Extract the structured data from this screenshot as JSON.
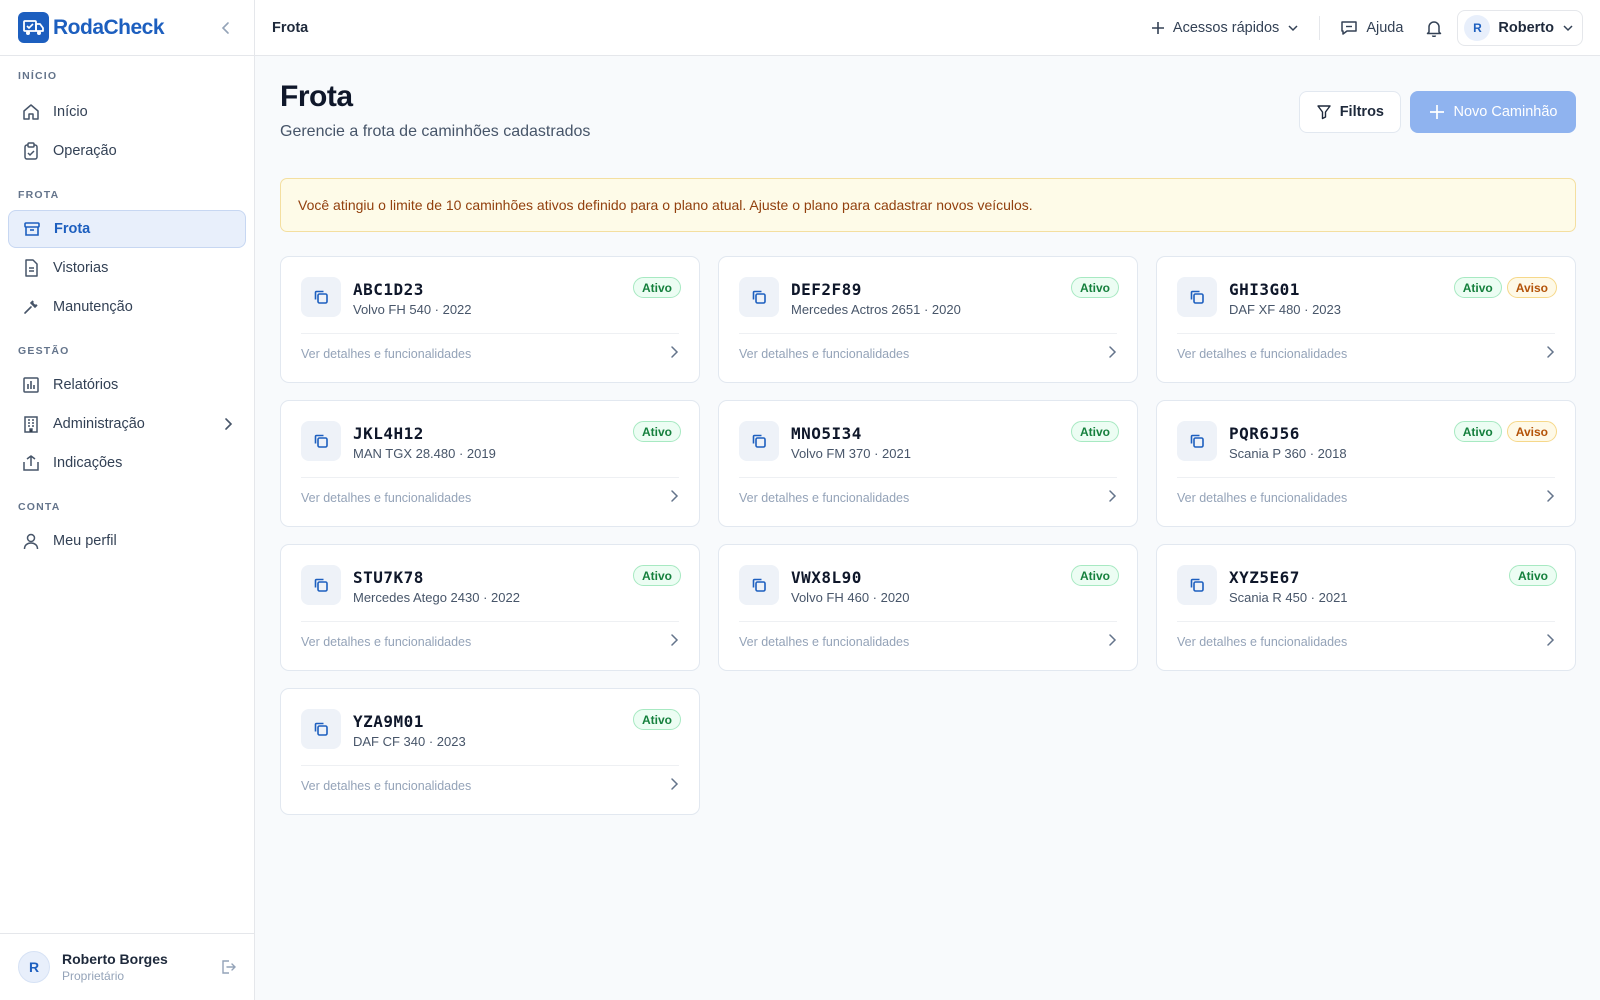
{
  "brand": {
    "name": "RodaCheck",
    "accent": "#1d5fbf"
  },
  "sidebar": {
    "sections": [
      {
        "label": "INÍCIO",
        "items": [
          {
            "label": "Início",
            "icon": "home-icon"
          },
          {
            "label": "Operação",
            "icon": "clipboard-icon"
          }
        ]
      },
      {
        "label": "FROTA",
        "items": [
          {
            "label": "Frota",
            "icon": "archive-icon",
            "active": true
          },
          {
            "label": "Vistorias",
            "icon": "document-icon"
          },
          {
            "label": "Manutenção",
            "icon": "wrench-icon"
          }
        ]
      },
      {
        "label": "GESTÃO",
        "items": [
          {
            "label": "Relatórios",
            "icon": "chart-icon"
          },
          {
            "label": "Administração",
            "icon": "building-icon",
            "has_submenu": true
          },
          {
            "label": "Indicações",
            "icon": "share-icon"
          }
        ]
      },
      {
        "label": "CONTA",
        "items": [
          {
            "label": "Meu perfil",
            "icon": "user-icon"
          }
        ]
      }
    ],
    "footer": {
      "avatar_initial": "R",
      "name": "Roberto Borges",
      "role": "Proprietário"
    }
  },
  "topbar": {
    "title": "Frota",
    "quick_access": "Acessos rápidos",
    "help": "Ajuda",
    "user_initial": "R",
    "user_name": "Roberto"
  },
  "page": {
    "title": "Frota",
    "subtitle": "Gerencie a frota de caminhões cadastrados",
    "filters_button": "Filtros",
    "new_button": "Novo Caminhão",
    "alert": "Você atingiu o limite de 10 caminhões ativos definido para o plano atual. Ajuste o plano para cadastrar novos veículos."
  },
  "trucks": [
    {
      "plate": "ABC1D23",
      "model": "Volvo FH 540 · 2022",
      "badges": [
        "Ativo"
      ],
      "link": "Ver detalhes e funcionalidades"
    },
    {
      "plate": "DEF2F89",
      "model": "Mercedes Actros 2651 · 2020",
      "badges": [
        "Ativo"
      ],
      "link": "Ver detalhes e funcionalidades"
    },
    {
      "plate": "GHI3G01",
      "model": "DAF XF 480 · 2023",
      "badges": [
        "Ativo",
        "Aviso"
      ],
      "link": "Ver detalhes e funcionalidades"
    },
    {
      "plate": "JKL4H12",
      "model": "MAN TGX 28.480 · 2019",
      "badges": [
        "Ativo"
      ],
      "link": "Ver detalhes e funcionalidades"
    },
    {
      "plate": "MNO5I34",
      "model": "Volvo FM 370 · 2021",
      "badges": [
        "Ativo"
      ],
      "link": "Ver detalhes e funcionalidades"
    },
    {
      "plate": "PQR6J56",
      "model": "Scania P 360 · 2018",
      "badges": [
        "Ativo",
        "Aviso"
      ],
      "link": "Ver detalhes e funcionalidades"
    },
    {
      "plate": "STU7K78",
      "model": "Mercedes Atego 2430 · 2022",
      "badges": [
        "Ativo"
      ],
      "link": "Ver detalhes e funcionalidades"
    },
    {
      "plate": "VWX8L90",
      "model": "Volvo FH 460 · 2020",
      "badges": [
        "Ativo"
      ],
      "link": "Ver detalhes e funcionalidades"
    },
    {
      "plate": "XYZ5E67",
      "model": "Scania R 450 · 2021",
      "badges": [
        "Ativo"
      ],
      "link": "Ver detalhes e funcionalidades"
    },
    {
      "plate": "YZA9M01",
      "model": "DAF CF 340 · 2023",
      "badges": [
        "Ativo"
      ],
      "link": "Ver detalhes e funcionalidades"
    }
  ]
}
